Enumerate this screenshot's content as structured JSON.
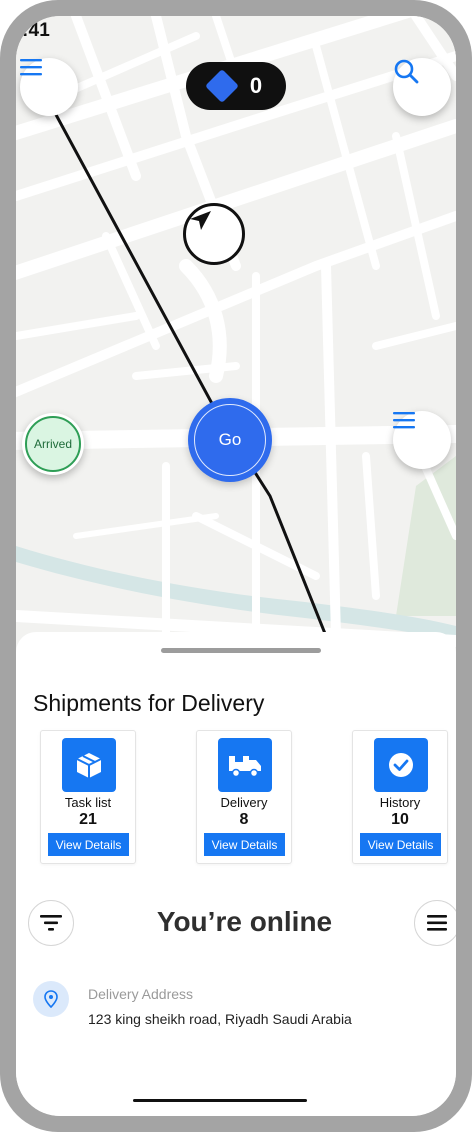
{
  "status_bar": {
    "time": ":41"
  },
  "map": {
    "points_value": "0",
    "go_label": "Go",
    "arrived_label": "Arrived"
  },
  "sheet": {
    "title": "Shipments for Delivery",
    "cards": [
      {
        "label": "Task list",
        "count": "21",
        "button": "View Details",
        "icon": "box-icon"
      },
      {
        "label": "Delivery",
        "count": "8",
        "button": "View Details",
        "icon": "truck-icon"
      },
      {
        "label": "History",
        "count": "10",
        "button": "View Details",
        "icon": "check-icon"
      }
    ],
    "online_title": "You’re online",
    "address": {
      "label": "Delivery Address",
      "value": "123 king sheikh road, Riyadh Saudi Arabia"
    }
  },
  "colors": {
    "accent": "#1677f2",
    "go_button": "#2f6bed",
    "arrived_bg": "#daf5e2",
    "arrived_border": "#2e9e56",
    "pill_bg": "#101010"
  }
}
